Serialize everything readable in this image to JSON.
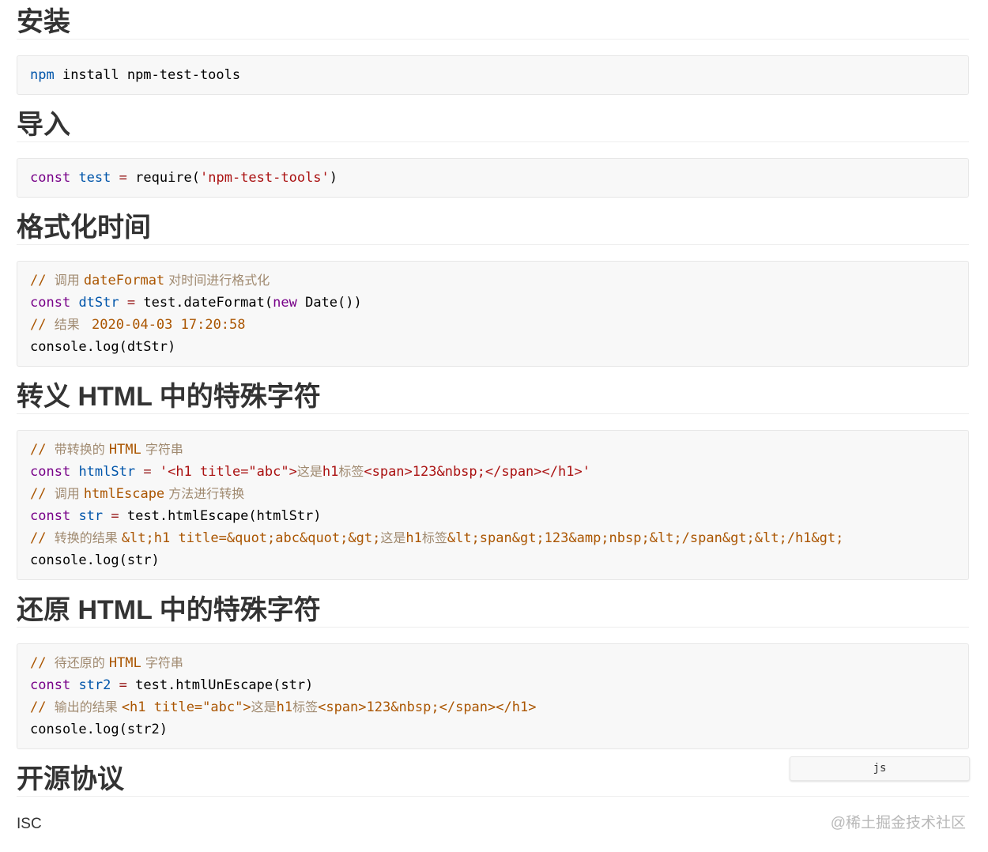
{
  "sections": [
    {
      "title": "安装",
      "code": [
        [
          [
            "npm",
            "def"
          ],
          [
            " install npm-test-tools",
            ""
          ]
        ]
      ]
    },
    {
      "title": "导入",
      "code": [
        [
          [
            "const",
            "kw"
          ],
          [
            " ",
            ""
          ],
          [
            "test",
            "def"
          ],
          [
            " ",
            ""
          ],
          [
            "=",
            "op"
          ],
          [
            " require(",
            ""
          ],
          [
            "'npm-test-tools'",
            "str"
          ],
          [
            ")",
            ""
          ]
        ]
      ]
    },
    {
      "title": "格式化时间",
      "code": [
        [
          [
            "// ",
            "com"
          ],
          [
            "调用 ",
            "cm"
          ],
          [
            "dateFormat",
            "com"
          ],
          [
            " 对时间进行格式化",
            "cm"
          ]
        ],
        [
          [
            "const",
            "kw"
          ],
          [
            " ",
            ""
          ],
          [
            "dtStr",
            "def"
          ],
          [
            " ",
            ""
          ],
          [
            "=",
            "op"
          ],
          [
            " test.dateFormat(",
            ""
          ],
          [
            "new",
            "kw"
          ],
          [
            " Date())",
            ""
          ]
        ],
        [
          [
            "// ",
            "com"
          ],
          [
            "结果 ",
            "cm"
          ],
          [
            " 2020-04-03 17:20:58",
            "com"
          ]
        ],
        [
          [
            "console.log(dtStr)",
            ""
          ]
        ]
      ]
    },
    {
      "title": "转义 HTML 中的特殊字符",
      "code": [
        [
          [
            "// ",
            "com"
          ],
          [
            "带转换的 ",
            "cm"
          ],
          [
            "HTML",
            "com"
          ],
          [
            " 字符串",
            "cm"
          ]
        ],
        [
          [
            "const",
            "kw"
          ],
          [
            " ",
            ""
          ],
          [
            "htmlStr",
            "def"
          ],
          [
            " ",
            ""
          ],
          [
            "=",
            "op"
          ],
          [
            " ",
            ""
          ],
          [
            "'<h1 title=\"abc\">",
            "str"
          ],
          [
            "这是",
            "cm"
          ],
          [
            "h1",
            "str"
          ],
          [
            "标签",
            "cm"
          ],
          [
            "<span>123&nbsp;</span></h1>'",
            "str"
          ]
        ],
        [
          [
            "// ",
            "com"
          ],
          [
            "调用 ",
            "cm"
          ],
          [
            "htmlEscape",
            "com"
          ],
          [
            " 方法进行转换",
            "cm"
          ]
        ],
        [
          [
            "const",
            "kw"
          ],
          [
            " ",
            ""
          ],
          [
            "str",
            "def"
          ],
          [
            " ",
            ""
          ],
          [
            "=",
            "op"
          ],
          [
            " test.htmlEscape(htmlStr)",
            ""
          ]
        ],
        [
          [
            "// ",
            "com"
          ],
          [
            "转换的结果 ",
            "cm"
          ],
          [
            "&lt;h1 title=&quot;abc&quot;&gt;",
            "com"
          ],
          [
            "这是",
            "cm"
          ],
          [
            "h1",
            "com"
          ],
          [
            "标签",
            "cm"
          ],
          [
            "&lt;span&gt;123&amp;nbsp;&lt;/span&gt;&lt;/h1&gt;",
            "com"
          ]
        ],
        [
          [
            "console.log(str)",
            ""
          ]
        ]
      ]
    },
    {
      "title": "还原 HTML 中的特殊字符",
      "code": [
        [
          [
            "// ",
            "com"
          ],
          [
            "待还原的 ",
            "cm"
          ],
          [
            "HTML",
            "com"
          ],
          [
            " 字符串",
            "cm"
          ]
        ],
        [
          [
            "const",
            "kw"
          ],
          [
            " ",
            ""
          ],
          [
            "str2",
            "def"
          ],
          [
            " ",
            ""
          ],
          [
            "=",
            "op"
          ],
          [
            " test.htmlUnEscape(str)",
            ""
          ]
        ],
        [
          [
            "// ",
            "com"
          ],
          [
            "输出的结果 ",
            "cm"
          ],
          [
            "<h1 title=\"abc\">",
            "com"
          ],
          [
            "这是",
            "cm"
          ],
          [
            "h1",
            "com"
          ],
          [
            "标签",
            "cm"
          ],
          [
            "<span>123&nbsp;</span></h1>",
            "com"
          ]
        ],
        [
          [
            "console.log(str2)",
            ""
          ]
        ]
      ]
    },
    {
      "title": "开源协议",
      "text": "ISC"
    }
  ],
  "lang_label": "js",
  "watermark": "@稀土掘金技术社区"
}
